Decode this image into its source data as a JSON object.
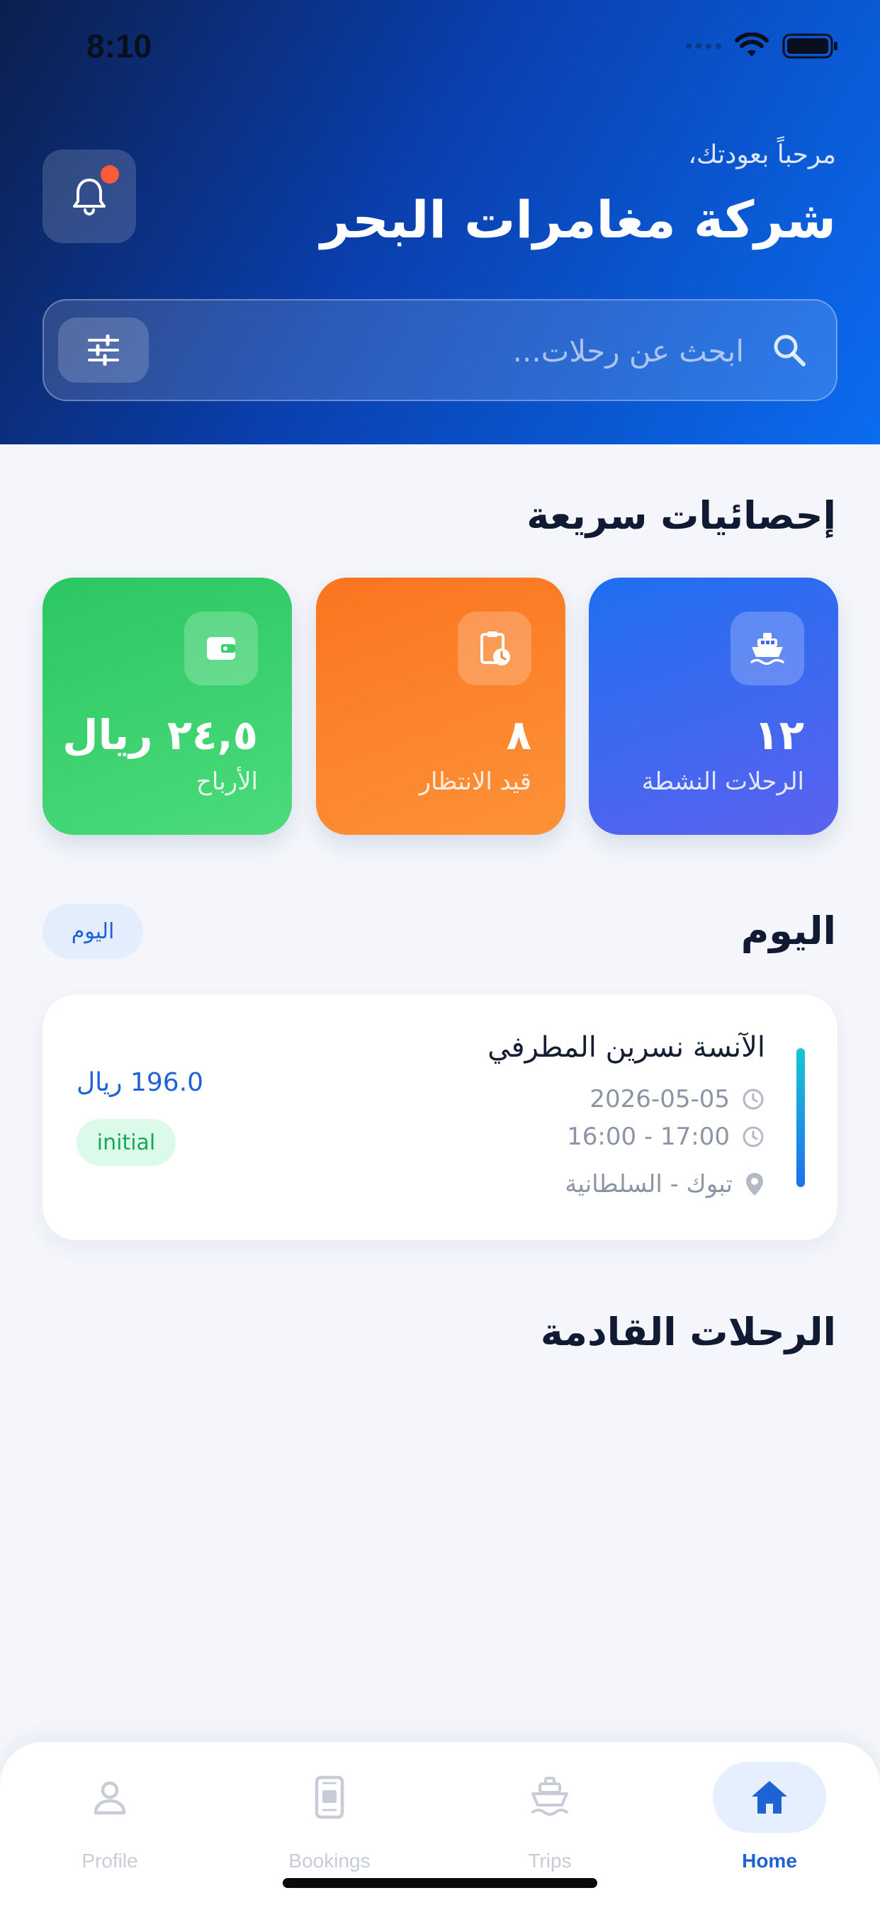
{
  "status_bar": {
    "time": "8:10"
  },
  "header": {
    "greeting": "مرحباً بعودتك،",
    "company_name": "شركة مغامرات البحر"
  },
  "search": {
    "placeholder": "ابحث عن رحلات..."
  },
  "stats": {
    "title": "إحصائيات سريعة",
    "cards": [
      {
        "value": "١٢",
        "label": "الرحلات النشطة",
        "icon": "ship-icon",
        "color": "#1f6ff0"
      },
      {
        "value": "٨",
        "label": "قيد الانتظار",
        "icon": "clipboard-clock-icon",
        "color": "#fb7420"
      },
      {
        "value": "٢٤,٥ ريال",
        "label": "الأرباح",
        "icon": "wallet-icon",
        "color": "#2bc763"
      }
    ]
  },
  "today": {
    "title": "اليوم",
    "chip": "اليوم",
    "booking": {
      "customer": "الآنسة نسرين المطرفي",
      "date": "2026-05-05",
      "time": "16:00 - 17:00",
      "location": "تبوك - السلطانية",
      "price": "196.0 ريال",
      "status": "initial"
    }
  },
  "upcoming": {
    "title": "الرحلات القادمة"
  },
  "nav": {
    "items": [
      {
        "label": "Profile",
        "icon": "person-icon"
      },
      {
        "label": "Bookings",
        "icon": "ticket-icon"
      },
      {
        "label": "Trips",
        "icon": "ship-icon"
      },
      {
        "label": "Home",
        "icon": "home-icon",
        "active": true
      }
    ]
  },
  "colors": {
    "primary": "#1e62d6",
    "header_dark": "#0c1f4d",
    "header_light": "#0b6cf0",
    "accent_notification": "#ff5b3a"
  }
}
